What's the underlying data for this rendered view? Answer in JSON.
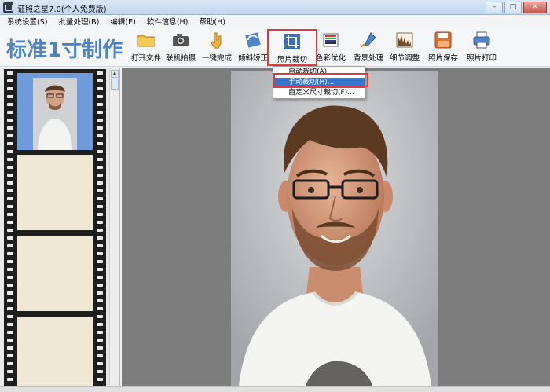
{
  "window": {
    "title": "证照之星7.0(个人免费版)",
    "minimize": "–",
    "maximize": "□",
    "close": "✕"
  },
  "menubar": {
    "items": [
      "系统设置(S)",
      "批量处理(B)",
      "编辑(E)",
      "软件信息(H)",
      "帮助(H)"
    ]
  },
  "toolbar": {
    "brand": "标准1寸制作",
    "tools": [
      {
        "label": "打开文件",
        "icon": "folder-icon"
      },
      {
        "label": "联机拍摄",
        "icon": "camera-icon"
      },
      {
        "label": "一键完成",
        "icon": "hand-pointer-icon"
      },
      {
        "label": "倾斜矫正",
        "icon": "rotate-icon"
      },
      {
        "label": "照片裁切",
        "icon": "crop-icon",
        "active": true
      },
      {
        "label": "色彩优化",
        "icon": "color-bars-icon"
      },
      {
        "label": "背景处理",
        "icon": "brush-icon"
      },
      {
        "label": "细节调整",
        "icon": "levels-icon"
      },
      {
        "label": "照片保存",
        "icon": "floppy-disk-icon"
      },
      {
        "label": "照片打印",
        "icon": "printer-icon"
      }
    ]
  },
  "crop_menu": {
    "items": [
      {
        "label": "自动裁切(A)"
      },
      {
        "label": "手动裁切(H)...",
        "selected": true
      },
      {
        "label": "自定义尺寸裁切(F)..."
      }
    ]
  },
  "colors": {
    "brand": "#4d84c4",
    "highlight": "#e03a3a",
    "menu_selected": "#3874c9",
    "canvas_bg": "#7d7d7d",
    "photo_bg": "#6e9bd9"
  }
}
